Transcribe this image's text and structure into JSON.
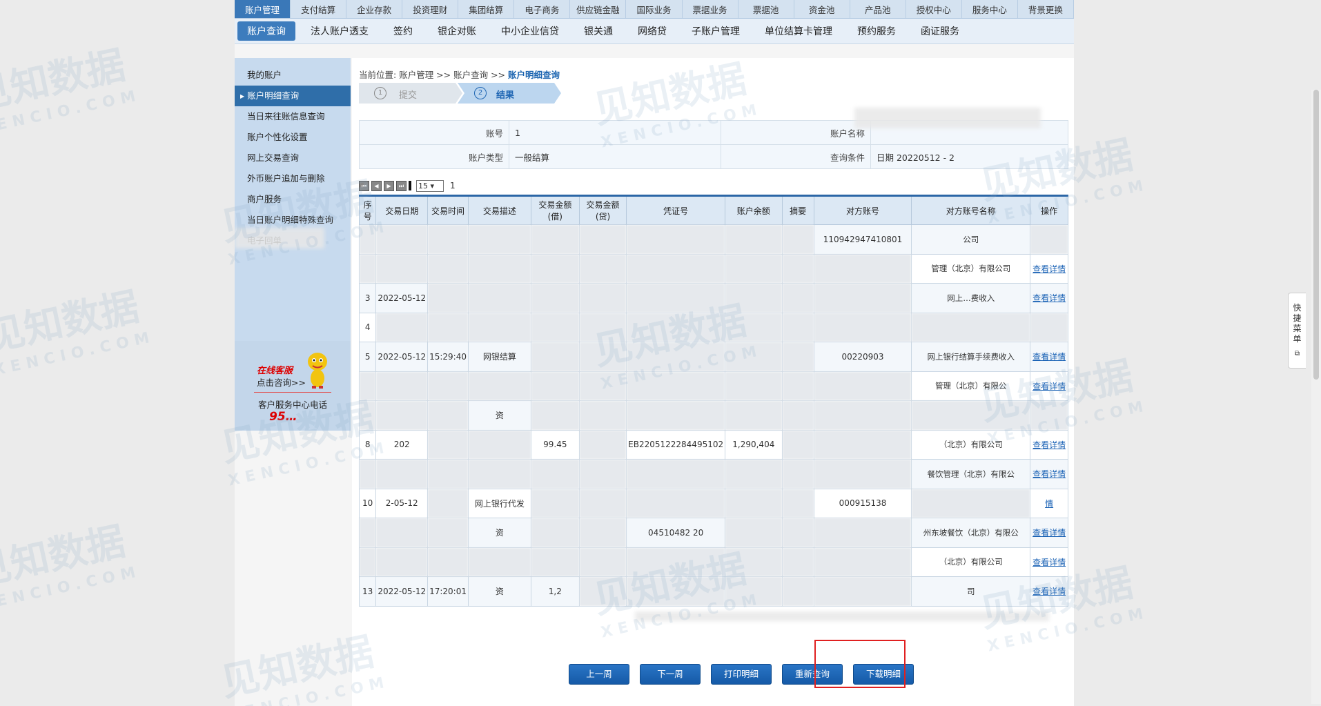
{
  "top_nav": [
    "账户管理",
    "支付结算",
    "企业存款",
    "投资理财",
    "集团结算",
    "电子商务",
    "供应链金融",
    "国际业务",
    "票据业务",
    "票据池",
    "资金池",
    "产品池",
    "授权中心",
    "服务中心",
    "背景更换"
  ],
  "sub_nav": [
    "账户查询",
    "法人账户透支",
    "签约",
    "银企对账",
    "中小企业信贷",
    "银关通",
    "网络贷",
    "子账户管理",
    "单位结算卡管理",
    "预约服务",
    "函证服务"
  ],
  "sidebar": [
    "我的账户",
    "账户明细查询",
    "当日来往账信息查询",
    "账户个性化设置",
    "网上交易查询",
    "外币账户追加与删除",
    "商户服务",
    "当日账户明细特殊查询",
    "电子回单"
  ],
  "service": {
    "online": "在线客服",
    "consult": "点击咨询>>",
    "phone_label": "客户服务中心电话",
    "phone": "95…"
  },
  "breadcrumb": {
    "prefix": "当前位置:",
    "path": "账户管理 >> 账户查询 >>",
    "current": "账户明细查询"
  },
  "steps": [
    {
      "num": "1",
      "label": "提交"
    },
    {
      "num": "2",
      "label": "结果"
    }
  ],
  "info": {
    "account_label": "账号",
    "account_value": "1",
    "account_name_label": "账户名称",
    "account_name_value": "",
    "type_label": "账户类型",
    "type_value": "一般结算",
    "cond_label": "查询条件",
    "cond_value": "日期 20220512 - 2"
  },
  "pager": {
    "page_size": "15",
    "page": "1"
  },
  "columns": [
    "序号",
    "交易日期",
    "交易时间",
    "交易描述",
    "交易金额(借)",
    "交易金额(贷)",
    "凭证号",
    "账户余额",
    "摘要",
    "对方账号",
    "对方账号名称",
    "操作"
  ],
  "rows": [
    {
      "no": "",
      "date": "",
      "time": "",
      "desc": "",
      "debit": "",
      "credit": "",
      "voucher": "",
      "balance": "",
      "memo": "",
      "acct": "110942947410801",
      "name": "公司",
      "op": ""
    },
    {
      "no": "",
      "date": "",
      "time": "",
      "desc": "",
      "debit": "",
      "credit": "",
      "voucher": "",
      "balance": "",
      "memo": "",
      "acct": "",
      "name": "管理（北京）有限公司",
      "op": "查看详情"
    },
    {
      "no": "3",
      "date": "2022-05-12",
      "time": "",
      "desc": "",
      "debit": "",
      "credit": "",
      "voucher": "",
      "balance": "",
      "memo": "",
      "acct": "",
      "name": "网上…费收入",
      "op": "查看详情"
    },
    {
      "no": "4",
      "date": "",
      "time": "",
      "desc": "",
      "debit": "",
      "credit": "",
      "voucher": "",
      "balance": "",
      "memo": "",
      "acct": "",
      "name": "",
      "op": ""
    },
    {
      "no": "5",
      "date": "2022-05-12",
      "time": "15:29:40",
      "desc": "网银结算",
      "debit": "",
      "credit": "",
      "voucher": "",
      "balance": "",
      "memo": "",
      "acct": "00220903",
      "name": "网上银行结算手续费收入",
      "op": "查看详情"
    },
    {
      "no": "",
      "date": "",
      "time": "",
      "desc": "",
      "debit": "",
      "credit": "",
      "voucher": "",
      "balance": "",
      "memo": "",
      "acct": "",
      "name": "管理（北京）有限公",
      "op": "查看详情"
    },
    {
      "no": "",
      "date": "",
      "time": "",
      "desc": "资",
      "debit": "",
      "credit": "",
      "voucher": "",
      "balance": "",
      "memo": "",
      "acct": "",
      "name": "",
      "op": ""
    },
    {
      "no": "8",
      "date": "202",
      "time": "",
      "desc": "",
      "debit": "99.45",
      "credit": "",
      "voucher": "EB2205122284495102",
      "balance": "1,290,404",
      "memo": "",
      "acct": "",
      "name": "（北京）有限公司",
      "op": "查看详情"
    },
    {
      "no": "",
      "date": "",
      "time": "",
      "desc": "",
      "debit": "",
      "credit": "",
      "voucher": "",
      "balance": "",
      "memo": "",
      "acct": "",
      "name": "餐饮管理（北京）有限公",
      "op": "查看详情"
    },
    {
      "no": "10",
      "date": "2-05-12",
      "time": "",
      "desc": "网上银行代发",
      "debit": "",
      "credit": "",
      "voucher": "",
      "balance": "",
      "memo": "",
      "acct": "000915138",
      "name": "",
      "op": "情"
    },
    {
      "no": "",
      "date": "",
      "time": "",
      "desc": "资",
      "debit": "",
      "credit": "",
      "voucher": "04510482 20",
      "balance": "",
      "memo": "",
      "acct": "",
      "name": "州东坡餐饮（北京）有限公",
      "op": "查看详情"
    },
    {
      "no": "",
      "date": "",
      "time": "",
      "desc": "",
      "debit": "",
      "credit": "",
      "voucher": "",
      "balance": "",
      "memo": "",
      "acct": "",
      "name": "（北京）有限公司",
      "op": "查看详情"
    },
    {
      "no": "13",
      "date": "2022-05-12",
      "time": "17:20:01",
      "desc": "资",
      "debit": "1,2",
      "credit": "",
      "voucher": "",
      "balance": "",
      "memo": "",
      "acct": "",
      "name": "司",
      "op": "查看详情"
    }
  ],
  "buttons": [
    "上一周",
    "下一周",
    "打印明细",
    "重新查询",
    "下载明细"
  ],
  "quick_menu": "快捷菜单",
  "watermark": {
    "cn": "见知数据",
    "en": "XENCIO.COM"
  }
}
